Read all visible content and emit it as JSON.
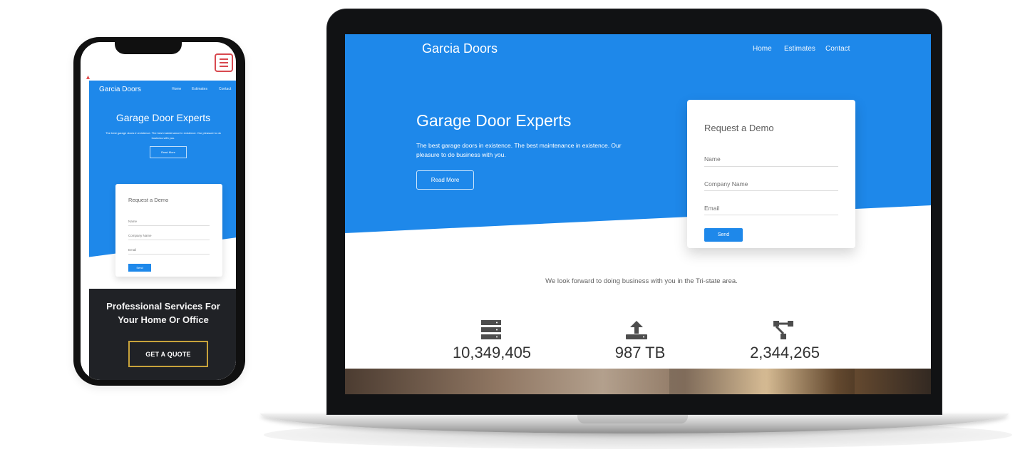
{
  "desktop": {
    "brand": "Garcia Doors",
    "nav": [
      "Home",
      "Estimates",
      "Contact"
    ],
    "hero": {
      "title": "Garage Door Experts",
      "subtitle": "The best garage doors in existence. The best maintenance in existence. Our pleasure to do business with you.",
      "button": "Read More"
    },
    "demo_form": {
      "title": "Request a Demo",
      "fields": [
        "Name",
        "Company Name",
        "Email"
      ],
      "button": "Send"
    },
    "tagline": "We look forward to doing business with you in the Tri-state area.",
    "stats": [
      {
        "icon": "server-icon",
        "value": "10,349,405"
      },
      {
        "icon": "upload-icon",
        "value": "987 TB"
      },
      {
        "icon": "network-icon",
        "value": "2,344,265"
      }
    ]
  },
  "mobile": {
    "brand": "Garcia Doors",
    "nav": [
      "Home",
      "Estimates",
      "Contact"
    ],
    "hero": {
      "title": "Garage Door Experts",
      "subtitle": "The best garage doors in existence. The best maintenance in existence. Our pleasure to do business with you.",
      "button": "Read More"
    },
    "demo_form": {
      "title": "Request a Demo",
      "fields": [
        "Name",
        "Company Name",
        "Email"
      ],
      "button": "Send"
    },
    "services_title": "Professional Services For Your Home Or Office",
    "cta": "GET A QUOTE"
  },
  "colors": {
    "primary_blue": "#1e88ea",
    "dark_band": "#202226",
    "cta_border": "#c8a33b",
    "menu_red": "#d8494f"
  }
}
